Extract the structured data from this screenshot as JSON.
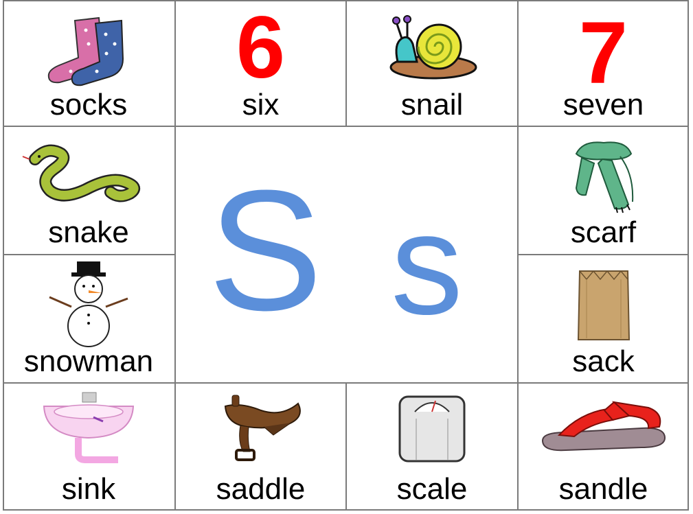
{
  "cells": {
    "socks": "socks",
    "six": "six",
    "six_numeral": "6",
    "snail": "snail",
    "seven": "seven",
    "seven_numeral": "7",
    "snake": "snake",
    "scarf": "scarf",
    "snowman": "snowman",
    "sack": "sack",
    "sink": "sink",
    "saddle": "saddle",
    "scale": "scale",
    "sandle": "sandle"
  },
  "center": {
    "upper": "S",
    "lower": "s"
  },
  "colors": {
    "letter": "#5b8fda",
    "numeral": "#ff0000",
    "grid": "#7a7a7a"
  }
}
